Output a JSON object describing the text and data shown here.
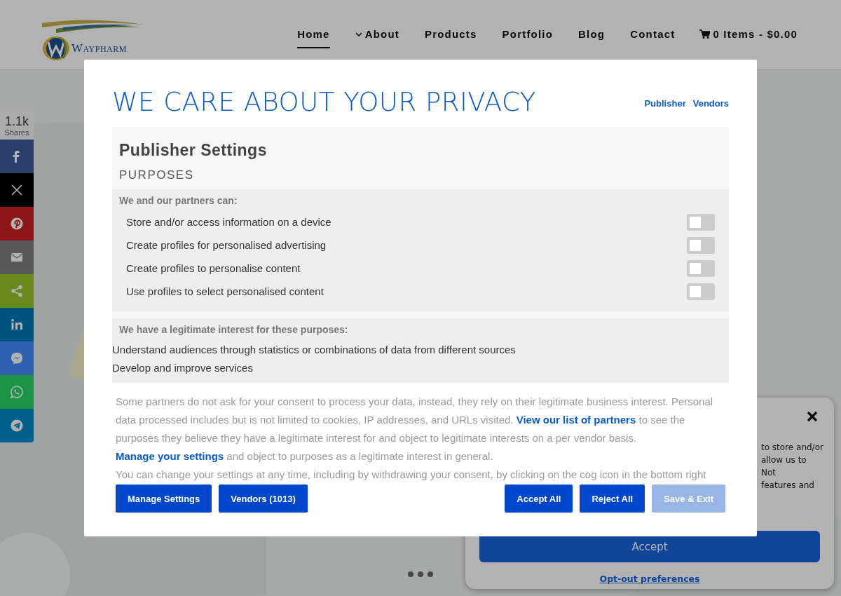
{
  "header": {
    "logo_text": "Waypharm",
    "nav": [
      {
        "label": "Home",
        "selected": true,
        "dropdown": false
      },
      {
        "label": "About",
        "selected": false,
        "dropdown": true
      },
      {
        "label": "Products",
        "selected": false,
        "dropdown": false
      },
      {
        "label": "Portfolio",
        "selected": false,
        "dropdown": false
      },
      {
        "label": "Blog",
        "selected": false,
        "dropdown": false
      },
      {
        "label": "Contact",
        "selected": false,
        "dropdown": false
      }
    ],
    "cart": "0 Items - $0.00"
  },
  "share_bar": {
    "count": "1.1k",
    "count_label": "Shares",
    "buttons": [
      {
        "kind": "facebook",
        "color": "#293e6a"
      },
      {
        "kind": "x",
        "color": "#000000"
      },
      {
        "kind": "pinterest",
        "color": "#8e161b"
      },
      {
        "kind": "email",
        "color": "#585858"
      },
      {
        "kind": "share",
        "color": "#688a1d"
      },
      {
        "kind": "linkedin",
        "color": "#00537f"
      },
      {
        "kind": "messenger",
        "color": "#3061b3"
      },
      {
        "kind": "whatsapp",
        "color": "#1a9447"
      },
      {
        "kind": "telegram",
        "color": "#005f8f"
      }
    ]
  },
  "cookie_notice": {
    "lines": [
      "to store and/or",
      "allow us to",
      "Not",
      "features and"
    ],
    "accept": "Accept",
    "link": "Opt-out preferences"
  },
  "privacy_modal": {
    "title": "WE CARE ABOUT YOUR PRIVACY",
    "top_links": [
      "Publisher",
      "Vendors"
    ],
    "section_title": "Publisher Settings",
    "subtitle": "PURPOSES",
    "consent_heading": "We and our partners can:",
    "purposes": [
      {
        "label": "Store and/or access information on a device",
        "checked": false
      },
      {
        "label": "Create profiles for personalised advertising",
        "checked": false
      },
      {
        "label": "Create profiles to personalise content",
        "checked": false
      },
      {
        "label": "Use profiles to select personalised content",
        "checked": false
      }
    ],
    "legitimate_heading": "We have a legitimate interest for these purposes:",
    "legitimate_items": [
      "Understand audiences through statistics or combinations of data from different sources",
      "Develop and improve services"
    ],
    "notice": [
      {
        "kind": "text",
        "text": "Some partners do not ask for your consent to process your data, instead, they rely on their legitimate business interest. Personal data processed includes but is not limited to cookies, IP addresses, and URLs visited. "
      },
      {
        "kind": "link",
        "text": "View our list of partners"
      },
      {
        "kind": "text",
        "text": " to see the purposes they believe they have a legitimate interest for and object to legitimate interests on a per vendor basis. "
      },
      {
        "kind": "link",
        "text": "Manage your settings"
      },
      {
        "kind": "text",
        "text": " and object to purposes as a legitimate interest in general."
      }
    ],
    "notice_2": "You can change your settings at any time, including by withdrawing your consent, by clicking on the cog icon in the bottom right",
    "buttons_left": [
      {
        "label": "Manage Settings",
        "disabled": false
      },
      {
        "label": "Vendors (1013)",
        "disabled": false
      }
    ],
    "buttons_right": [
      {
        "label": "Accept All",
        "disabled": false
      },
      {
        "label": "Reject All",
        "disabled": false
      },
      {
        "label": "Save & Exit",
        "disabled": true
      }
    ]
  }
}
